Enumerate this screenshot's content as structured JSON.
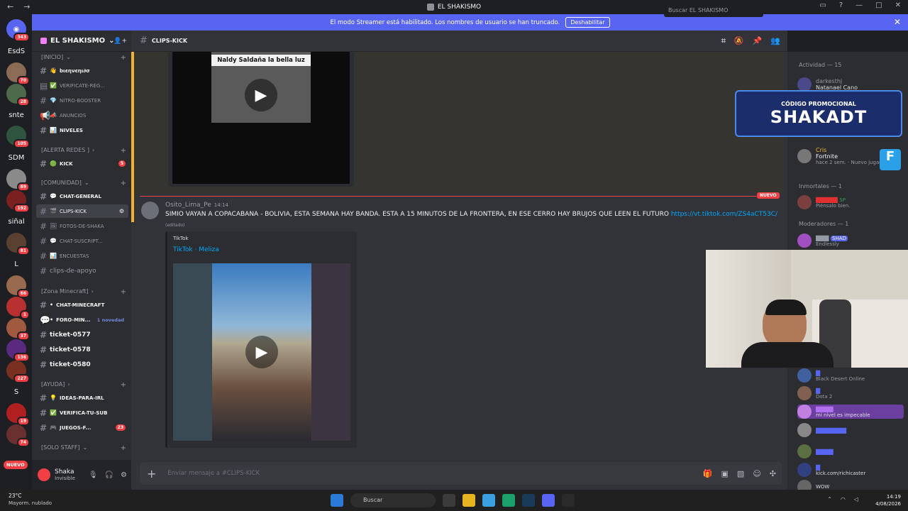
{
  "window": {
    "title": "EL SHAKISMO"
  },
  "streamer_banner": {
    "message": "El modo Streamer está habilitado. Los nombres de usuario se han truncado.",
    "button": "Deshabilitar"
  },
  "guilds": [
    {
      "label": "",
      "badge": "343"
    },
    {
      "label": "EsdS",
      "badge": ""
    },
    {
      "label": "",
      "badge": "70"
    },
    {
      "label": "",
      "badge": "28"
    },
    {
      "label": "snte",
      "badge": ""
    },
    {
      "label": "",
      "badge": "105"
    },
    {
      "label": "SDM",
      "badge": ""
    },
    {
      "label": "",
      "badge": "89"
    },
    {
      "label": "",
      "badge": "192"
    },
    {
      "label": "siñal",
      "badge": ""
    },
    {
      "label": "",
      "badge": "81"
    },
    {
      "label": "L",
      "badge": ""
    },
    {
      "label": "",
      "badge": "66"
    },
    {
      "label": "",
      "badge": "1"
    },
    {
      "label": "",
      "badge": "37"
    },
    {
      "label": "",
      "badge": "136"
    },
    {
      "label": "",
      "badge": "227"
    },
    {
      "label": "S",
      "badge": ""
    },
    {
      "label": "",
      "badge": "19"
    },
    {
      "label": "",
      "badge": "74"
    }
  ],
  "guild_new": "NUEVO",
  "server": {
    "name": "EL SHAKISMO"
  },
  "categories": {
    "inicio": "[INICIO]",
    "alerta": "[ALERTA REDES ]",
    "comunidad": "[COMUNIDAD]",
    "minecraft": "[Zona Minecraft]",
    "ayuda": "[AYUDA]",
    "staff": "[SOLO STAFF]"
  },
  "channels": {
    "bienvenido": "bιєηνєηι∂σ",
    "verificate": "VERIFICATE-REG...",
    "nitro": "NITRO-BOOSTER",
    "anuncios": "ANUNCIOS",
    "niveles": "NIVELES",
    "kick": "KICK",
    "kick_badge": "5",
    "chat_general": "CHAT-GENERAL",
    "clips_kick": "CLIPS-KICK",
    "fotos": "FOTOS-DE-SHAKA",
    "chat_suscript": "CHAT-SUSCRIPT...",
    "encuestas": "ENCUESTAS",
    "clips_apoyo": "clips-de-apoyo",
    "chat_minecraft": "CHAT-MINECRAFT",
    "foro_min": "FORO-MIN...",
    "foro_novedad": "1 novedad",
    "ticket1": "ticket-0577",
    "ticket2": "ticket-0578",
    "ticket3": "ticket-0580",
    "ideas": "IDEAS-PARA-IRL",
    "verifica_sub": "VERIFICA-TU-SUB",
    "juegos": "JUEGOS-F...",
    "juegos_badge": "23"
  },
  "user": {
    "name": "Shaka",
    "status": "Invisible"
  },
  "chat_header": {
    "channel": "CLIPS-KICK"
  },
  "search": {
    "placeholder": "Buscar EL SHAKISMO"
  },
  "messages": {
    "video1_title": "Naldy Saldaña la bella luz",
    "new_label": "NUEVO",
    "author": "Osito_Lima_Pe",
    "time": "14:14",
    "text": "SIMIO VAYAN A COPACABANA - BOLIVIA, ESTA SEMANA HAY BANDA. ESTA A 15 MINUTOS DE LA FRONTERA, EN ESE CERRO HAY BRUJOS QUE LEEN EL FUTURO",
    "link": "https://vt.tiktok.com/ZS4aCT53C/",
    "edited": "(editado)",
    "embed_provider": "TikTok",
    "embed_title": "TikTok · Meliza"
  },
  "composer": {
    "placeholder": "Enviar mensaje a #CLIPS-KICK"
  },
  "members": {
    "activity": "Actividad — 15",
    "m1_name": "darkesthj",
    "m1_sub": "Natanael Cano",
    "m2_name": "Cris",
    "m2_game": "Fortnite",
    "m2_meta": "hace 2 sem.",
    "m2_extra": "Nuevo jugador",
    "sec_inmortales": "Inmortales — 1",
    "m3_status": "Piénsalo bien.",
    "m3_tag": "SP",
    "sec_moderadores": "Moderadores — 1",
    "m4_status": "Endlessly",
    "m4_tag": "SHAD",
    "m5_status": "Black Desert Online",
    "m6_status": "Dota 2",
    "m7_status": "mi nivel es impecable",
    "m9_status": "kick.com/richicaster",
    "m10_tag": "WOW"
  },
  "promo": {
    "line1": "CÓDIGO PROMOCIONAL",
    "line2": "SHAKADT"
  },
  "taskbar": {
    "temp": "23°C",
    "weather": "Mayorm. nublado",
    "search": "Buscar",
    "time": "14:19",
    "date": "4/08/2026"
  }
}
